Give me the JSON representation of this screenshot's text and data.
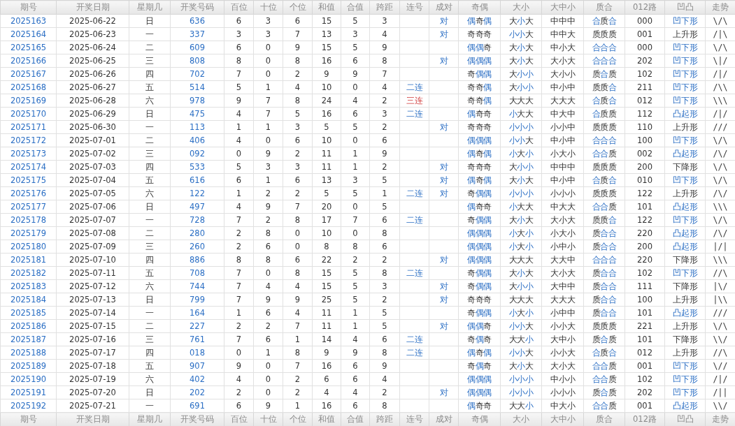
{
  "table": {
    "columns": [
      "期号",
      "开奖日期",
      "星期几",
      "开奖号码",
      "百位",
      "十位",
      "个位",
      "和值",
      "合值",
      "跨距",
      "连号",
      "成对",
      "奇偶",
      "大小",
      "大中小",
      "质合",
      "012路",
      "凹凸",
      "走势"
    ],
    "rows": [
      {
        "issue": "2025163",
        "date": "2025-06-22",
        "weekday": "日",
        "number": "636",
        "hundreds": "6",
        "tens": "3",
        "units": "6",
        "sum": "15",
        "sum_tail": "5",
        "span": "3",
        "pair": "对",
        "odd_even": [
          {
            "t": "偶",
            "highlighted": true
          },
          {
            "t": "奇",
            "highlighted": false
          },
          {
            "t": "偶",
            "highlighted": true
          }
        ],
        "big_small": [
          {
            "t": "大",
            "highlighted": false
          },
          {
            "t": "小",
            "highlighted": true
          },
          {
            "t": "大",
            "highlighted": false
          }
        ],
        "big_mid_small": "中中中",
        "prime": [
          {
            "t": "合",
            "highlighted": true
          },
          {
            "t": "质",
            "highlighted": false
          },
          {
            "t": "合",
            "highlighted": true
          }
        ],
        "route": "000",
        "shape": {
          "text": "凹下形",
          "kind": "link"
        },
        "trend": "\\/\\"
      },
      {
        "issue": "2025164",
        "date": "2025-06-23",
        "weekday": "一",
        "number": "337",
        "hundreds": "3",
        "tens": "3",
        "units": "7",
        "sum": "13",
        "sum_tail": "3",
        "span": "4",
        "pair": "对",
        "odd_even": [
          {
            "t": "奇奇奇",
            "highlighted": false
          }
        ],
        "big_small": [
          {
            "t": "小小",
            "highlighted": true
          },
          {
            "t": "大",
            "highlighted": false
          }
        ],
        "big_mid_small": "中中大",
        "prime": [
          {
            "t": "质质质",
            "highlighted": false
          }
        ],
        "route": "001",
        "shape": {
          "text": "上升形",
          "kind": "plain"
        },
        "trend": "/|\\"
      },
      {
        "issue": "2025165",
        "date": "2025-06-24",
        "weekday": "二",
        "number": "609",
        "hundreds": "6",
        "tens": "0",
        "units": "9",
        "sum": "15",
        "sum_tail": "5",
        "span": "9",
        "odd_even": [
          {
            "t": "偶偶",
            "highlighted": true
          },
          {
            "t": "奇",
            "highlighted": false
          }
        ],
        "big_small": [
          {
            "t": "大",
            "highlighted": false
          },
          {
            "t": "小",
            "highlighted": true
          },
          {
            "t": "大",
            "highlighted": false
          }
        ],
        "big_mid_small": "中小大",
        "prime": [
          {
            "t": "合合合",
            "highlighted": true
          }
        ],
        "route": "000",
        "shape": {
          "text": "凹下形",
          "kind": "link"
        },
        "trend": "\\/\\"
      },
      {
        "issue": "2025166",
        "date": "2025-06-25",
        "weekday": "三",
        "number": "808",
        "hundreds": "8",
        "tens": "0",
        "units": "8",
        "sum": "16",
        "sum_tail": "6",
        "span": "8",
        "pair": "对",
        "odd_even": [
          {
            "t": "偶偶偶",
            "highlighted": true
          }
        ],
        "big_small": [
          {
            "t": "大",
            "highlighted": false
          },
          {
            "t": "小",
            "highlighted": true
          },
          {
            "t": "大",
            "highlighted": false
          }
        ],
        "big_mid_small": "大小大",
        "prime": [
          {
            "t": "合合合",
            "highlighted": true
          }
        ],
        "route": "202",
        "shape": {
          "text": "凹下形",
          "kind": "link"
        },
        "trend": "\\|/"
      },
      {
        "issue": "2025167",
        "date": "2025-06-26",
        "weekday": "四",
        "number": "702",
        "hundreds": "7",
        "tens": "0",
        "units": "2",
        "sum": "9",
        "sum_tail": "9",
        "span": "7",
        "odd_even": [
          {
            "t": "奇",
            "highlighted": false
          },
          {
            "t": "偶偶",
            "highlighted": true
          }
        ],
        "big_small": [
          {
            "t": "大",
            "highlighted": false
          },
          {
            "t": "小小",
            "highlighted": true
          }
        ],
        "big_mid_small": "大小小",
        "prime": [
          {
            "t": "质",
            "highlighted": false
          },
          {
            "t": "合",
            "highlighted": true
          },
          {
            "t": "质",
            "highlighted": false
          }
        ],
        "route": "102",
        "shape": {
          "text": "凹下形",
          "kind": "link"
        },
        "trend": "/|/"
      },
      {
        "issue": "2025168",
        "date": "2025-06-27",
        "weekday": "五",
        "number": "514",
        "hundreds": "5",
        "tens": "1",
        "units": "4",
        "sum": "10",
        "sum_tail": "0",
        "span": "4",
        "consecutive": {
          "text": "二连",
          "kind": "link"
        },
        "odd_even": [
          {
            "t": "奇奇",
            "highlighted": false
          },
          {
            "t": "偶",
            "highlighted": true
          }
        ],
        "big_small": [
          {
            "t": "大",
            "highlighted": false
          },
          {
            "t": "小小",
            "highlighted": true
          }
        ],
        "big_mid_small": "中小中",
        "prime": [
          {
            "t": "质质",
            "highlighted": false
          },
          {
            "t": "合",
            "highlighted": true
          }
        ],
        "route": "211",
        "shape": {
          "text": "凹下形",
          "kind": "link"
        },
        "trend": "/\\\\"
      },
      {
        "issue": "2025169",
        "date": "2025-06-28",
        "weekday": "六",
        "number": "978",
        "hundreds": "9",
        "tens": "7",
        "units": "8",
        "sum": "24",
        "sum_tail": "4",
        "span": "2",
        "consecutive": {
          "text": "三连",
          "kind": "alert"
        },
        "odd_even": [
          {
            "t": "奇奇",
            "highlighted": false
          },
          {
            "t": "偶",
            "highlighted": true
          }
        ],
        "big_small": [
          {
            "t": "大大大",
            "highlighted": false
          }
        ],
        "big_mid_small": "大大大",
        "prime": [
          {
            "t": "合",
            "highlighted": true
          },
          {
            "t": "质",
            "highlighted": false
          },
          {
            "t": "合",
            "highlighted": true
          }
        ],
        "route": "012",
        "shape": {
          "text": "凹下形",
          "kind": "link"
        },
        "trend": "\\\\\\"
      },
      {
        "issue": "2025170",
        "date": "2025-06-29",
        "weekday": "日",
        "number": "475",
        "hundreds": "4",
        "tens": "7",
        "units": "5",
        "sum": "16",
        "sum_tail": "6",
        "span": "3",
        "consecutive": {
          "text": "二连",
          "kind": "link"
        },
        "odd_even": [
          {
            "t": "偶",
            "highlighted": true
          },
          {
            "t": "奇奇",
            "highlighted": false
          }
        ],
        "big_small": [
          {
            "t": "小",
            "highlighted": true
          },
          {
            "t": "大大",
            "highlighted": false
          }
        ],
        "big_mid_small": "中大中",
        "prime": [
          {
            "t": "合",
            "highlighted": true
          },
          {
            "t": "质质",
            "highlighted": false
          }
        ],
        "route": "112",
        "shape": {
          "text": "凸起形",
          "kind": "link"
        },
        "trend": "/|/"
      },
      {
        "issue": "2025171",
        "date": "2025-06-30",
        "weekday": "一",
        "number": "113",
        "hundreds": "1",
        "tens": "1",
        "units": "3",
        "sum": "5",
        "sum_tail": "5",
        "span": "2",
        "pair": "对",
        "odd_even": [
          {
            "t": "奇奇奇",
            "highlighted": false
          }
        ],
        "big_small": [
          {
            "t": "小小小",
            "highlighted": true
          }
        ],
        "big_mid_small": "小小中",
        "prime": [
          {
            "t": "质质质",
            "highlighted": false
          }
        ],
        "route": "110",
        "shape": {
          "text": "上升形",
          "kind": "plain"
        },
        "trend": "///"
      },
      {
        "issue": "2025172",
        "date": "2025-07-01",
        "weekday": "二",
        "number": "406",
        "hundreds": "4",
        "tens": "0",
        "units": "6",
        "sum": "10",
        "sum_tail": "0",
        "span": "6",
        "odd_even": [
          {
            "t": "偶偶偶",
            "highlighted": true
          }
        ],
        "big_small": [
          {
            "t": "小小",
            "highlighted": true
          },
          {
            "t": "大",
            "highlighted": false
          }
        ],
        "big_mid_small": "中小中",
        "prime": [
          {
            "t": "合合合",
            "highlighted": true
          }
        ],
        "route": "100",
        "shape": {
          "text": "凹下形",
          "kind": "link"
        },
        "trend": "\\/\\"
      },
      {
        "issue": "2025173",
        "date": "2025-07-02",
        "weekday": "三",
        "number": "092",
        "hundreds": "0",
        "tens": "9",
        "units": "2",
        "sum": "11",
        "sum_tail": "1",
        "span": "9",
        "odd_even": [
          {
            "t": "偶",
            "highlighted": true
          },
          {
            "t": "奇",
            "highlighted": false
          },
          {
            "t": "偶",
            "highlighted": true
          }
        ],
        "big_small": [
          {
            "t": "小",
            "highlighted": true
          },
          {
            "t": "大",
            "highlighted": false
          },
          {
            "t": "小",
            "highlighted": true
          }
        ],
        "big_mid_small": "小大小",
        "prime": [
          {
            "t": "合合",
            "highlighted": true
          },
          {
            "t": "质",
            "highlighted": false
          }
        ],
        "route": "002",
        "shape": {
          "text": "凸起形",
          "kind": "link"
        },
        "trend": "/\\/"
      },
      {
        "issue": "2025174",
        "date": "2025-07-03",
        "weekday": "四",
        "number": "533",
        "hundreds": "5",
        "tens": "3",
        "units": "3",
        "sum": "11",
        "sum_tail": "1",
        "span": "2",
        "pair": "对",
        "odd_even": [
          {
            "t": "奇奇奇",
            "highlighted": false
          }
        ],
        "big_small": [
          {
            "t": "大",
            "highlighted": false
          },
          {
            "t": "小小",
            "highlighted": true
          }
        ],
        "big_mid_small": "中中中",
        "prime": [
          {
            "t": "质质质",
            "highlighted": false
          }
        ],
        "route": "200",
        "shape": {
          "text": "下降形",
          "kind": "plain"
        },
        "trend": "\\/\\"
      },
      {
        "issue": "2025175",
        "date": "2025-07-04",
        "weekday": "五",
        "number": "616",
        "hundreds": "6",
        "tens": "1",
        "units": "6",
        "sum": "13",
        "sum_tail": "3",
        "span": "5",
        "pair": "对",
        "odd_even": [
          {
            "t": "偶",
            "highlighted": true
          },
          {
            "t": "奇",
            "highlighted": false
          },
          {
            "t": "偶",
            "highlighted": true
          }
        ],
        "big_small": [
          {
            "t": "大",
            "highlighted": false
          },
          {
            "t": "小",
            "highlighted": true
          },
          {
            "t": "大",
            "highlighted": false
          }
        ],
        "big_mid_small": "中小中",
        "prime": [
          {
            "t": "合",
            "highlighted": true
          },
          {
            "t": "质",
            "highlighted": false
          },
          {
            "t": "合",
            "highlighted": true
          }
        ],
        "route": "010",
        "shape": {
          "text": "凹下形",
          "kind": "link"
        },
        "trend": "\\/\\"
      },
      {
        "issue": "2025176",
        "date": "2025-07-05",
        "weekday": "六",
        "number": "122",
        "hundreds": "1",
        "tens": "2",
        "units": "2",
        "sum": "5",
        "sum_tail": "5",
        "span": "1",
        "consecutive": {
          "text": "二连",
          "kind": "link"
        },
        "pair": "对",
        "odd_even": [
          {
            "t": "奇",
            "highlighted": false
          },
          {
            "t": "偶偶",
            "highlighted": true
          }
        ],
        "big_small": [
          {
            "t": "小小小",
            "highlighted": true
          }
        ],
        "big_mid_small": "小小小",
        "prime": [
          {
            "t": "质质质",
            "highlighted": false
          }
        ],
        "route": "122",
        "shape": {
          "text": "上升形",
          "kind": "plain"
        },
        "trend": "/\\/"
      },
      {
        "issue": "2025177",
        "date": "2025-07-06",
        "weekday": "日",
        "number": "497",
        "hundreds": "4",
        "tens": "9",
        "units": "7",
        "sum": "20",
        "sum_tail": "0",
        "span": "5",
        "odd_even": [
          {
            "t": "偶",
            "highlighted": true
          },
          {
            "t": "奇奇",
            "highlighted": false
          }
        ],
        "big_small": [
          {
            "t": "小",
            "highlighted": true
          },
          {
            "t": "大大",
            "highlighted": false
          }
        ],
        "big_mid_small": "中大大",
        "prime": [
          {
            "t": "合合",
            "highlighted": true
          },
          {
            "t": "质",
            "highlighted": false
          }
        ],
        "route": "101",
        "shape": {
          "text": "凸起形",
          "kind": "link"
        },
        "trend": "\\\\\\"
      },
      {
        "issue": "2025178",
        "date": "2025-07-07",
        "weekday": "一",
        "number": "728",
        "hundreds": "7",
        "tens": "2",
        "units": "8",
        "sum": "17",
        "sum_tail": "7",
        "span": "6",
        "consecutive": {
          "text": "二连",
          "kind": "link"
        },
        "odd_even": [
          {
            "t": "奇",
            "highlighted": false
          },
          {
            "t": "偶偶",
            "highlighted": true
          }
        ],
        "big_small": [
          {
            "t": "大",
            "highlighted": false
          },
          {
            "t": "小",
            "highlighted": true
          },
          {
            "t": "大",
            "highlighted": false
          }
        ],
        "big_mid_small": "大小大",
        "prime": [
          {
            "t": "质质",
            "highlighted": false
          },
          {
            "t": "合",
            "highlighted": true
          }
        ],
        "route": "122",
        "shape": {
          "text": "凹下形",
          "kind": "link"
        },
        "trend": "\\/\\"
      },
      {
        "issue": "2025179",
        "date": "2025-07-08",
        "weekday": "二",
        "number": "280",
        "hundreds": "2",
        "tens": "8",
        "units": "0",
        "sum": "10",
        "sum_tail": "0",
        "span": "8",
        "odd_even": [
          {
            "t": "偶偶偶",
            "highlighted": true
          }
        ],
        "big_small": [
          {
            "t": "小",
            "highlighted": true
          },
          {
            "t": "大",
            "highlighted": false
          },
          {
            "t": "小",
            "highlighted": true
          }
        ],
        "big_mid_small": "小大小",
        "prime": [
          {
            "t": "质",
            "highlighted": false
          },
          {
            "t": "合合",
            "highlighted": true
          }
        ],
        "route": "220",
        "shape": {
          "text": "凸起形",
          "kind": "link"
        },
        "trend": "/\\/"
      },
      {
        "issue": "2025180",
        "date": "2025-07-09",
        "weekday": "三",
        "number": "260",
        "hundreds": "2",
        "tens": "6",
        "units": "0",
        "sum": "8",
        "sum_tail": "8",
        "span": "6",
        "odd_even": [
          {
            "t": "偶偶偶",
            "highlighted": true
          }
        ],
        "big_small": [
          {
            "t": "小",
            "highlighted": true
          },
          {
            "t": "大",
            "highlighted": false
          },
          {
            "t": "小",
            "highlighted": true
          }
        ],
        "big_mid_small": "小中小",
        "prime": [
          {
            "t": "质",
            "highlighted": false
          },
          {
            "t": "合合",
            "highlighted": true
          }
        ],
        "route": "200",
        "shape": {
          "text": "凸起形",
          "kind": "link"
        },
        "trend": "|/|"
      },
      {
        "issue": "2025181",
        "date": "2025-07-10",
        "weekday": "四",
        "number": "886",
        "hundreds": "8",
        "tens": "8",
        "units": "6",
        "sum": "22",
        "sum_tail": "2",
        "span": "2",
        "pair": "对",
        "odd_even": [
          {
            "t": "偶偶偶",
            "highlighted": true
          }
        ],
        "big_small": [
          {
            "t": "大大大",
            "highlighted": false
          }
        ],
        "big_mid_small": "大大中",
        "prime": [
          {
            "t": "合合合",
            "highlighted": true
          }
        ],
        "route": "220",
        "shape": {
          "text": "下降形",
          "kind": "plain"
        },
        "trend": "\\\\\\"
      },
      {
        "issue": "2025182",
        "date": "2025-07-11",
        "weekday": "五",
        "number": "708",
        "hundreds": "7",
        "tens": "0",
        "units": "8",
        "sum": "15",
        "sum_tail": "5",
        "span": "8",
        "consecutive": {
          "text": "二连",
          "kind": "link"
        },
        "odd_even": [
          {
            "t": "奇",
            "highlighted": false
          },
          {
            "t": "偶偶",
            "highlighted": true
          }
        ],
        "big_small": [
          {
            "t": "大",
            "highlighted": false
          },
          {
            "t": "小",
            "highlighted": true
          },
          {
            "t": "大",
            "highlighted": false
          }
        ],
        "big_mid_small": "大小大",
        "prime": [
          {
            "t": "质",
            "highlighted": false
          },
          {
            "t": "合合",
            "highlighted": true
          }
        ],
        "route": "102",
        "shape": {
          "text": "凹下形",
          "kind": "link"
        },
        "trend": "//\\"
      },
      {
        "issue": "2025183",
        "date": "2025-07-12",
        "weekday": "六",
        "number": "744",
        "hundreds": "7",
        "tens": "4",
        "units": "4",
        "sum": "15",
        "sum_tail": "5",
        "span": "3",
        "pair": "对",
        "odd_even": [
          {
            "t": "奇",
            "highlighted": false
          },
          {
            "t": "偶偶",
            "highlighted": true
          }
        ],
        "big_small": [
          {
            "t": "大",
            "highlighted": false
          },
          {
            "t": "小小",
            "highlighted": true
          }
        ],
        "big_mid_small": "大中中",
        "prime": [
          {
            "t": "质",
            "highlighted": false
          },
          {
            "t": "合合",
            "highlighted": true
          }
        ],
        "route": "111",
        "shape": {
          "text": "下降形",
          "kind": "plain"
        },
        "trend": "|\\/"
      },
      {
        "issue": "2025184",
        "date": "2025-07-13",
        "weekday": "日",
        "number": "799",
        "hundreds": "7",
        "tens": "9",
        "units": "9",
        "sum": "25",
        "sum_tail": "5",
        "span": "2",
        "pair": "对",
        "odd_even": [
          {
            "t": "奇奇奇",
            "highlighted": false
          }
        ],
        "big_small": [
          {
            "t": "大大大",
            "highlighted": false
          }
        ],
        "big_mid_small": "大大大",
        "prime": [
          {
            "t": "质",
            "highlighted": false
          },
          {
            "t": "合合",
            "highlighted": true
          }
        ],
        "route": "100",
        "shape": {
          "text": "上升形",
          "kind": "plain"
        },
        "trend": "|\\\\"
      },
      {
        "issue": "2025185",
        "date": "2025-07-14",
        "weekday": "一",
        "number": "164",
        "hundreds": "1",
        "tens": "6",
        "units": "4",
        "sum": "11",
        "sum_tail": "1",
        "span": "5",
        "odd_even": [
          {
            "t": "奇",
            "highlighted": false
          },
          {
            "t": "偶偶",
            "highlighted": true
          }
        ],
        "big_small": [
          {
            "t": "小",
            "highlighted": true
          },
          {
            "t": "大",
            "highlighted": false
          },
          {
            "t": "小",
            "highlighted": true
          }
        ],
        "big_mid_small": "小中中",
        "prime": [
          {
            "t": "质",
            "highlighted": false
          },
          {
            "t": "合合",
            "highlighted": true
          }
        ],
        "route": "101",
        "shape": {
          "text": "凸起形",
          "kind": "link"
        },
        "trend": "///"
      },
      {
        "issue": "2025186",
        "date": "2025-07-15",
        "weekday": "二",
        "number": "227",
        "hundreds": "2",
        "tens": "2",
        "units": "7",
        "sum": "11",
        "sum_tail": "1",
        "span": "5",
        "pair": "对",
        "odd_even": [
          {
            "t": "偶偶",
            "highlighted": true
          },
          {
            "t": "奇",
            "highlighted": false
          }
        ],
        "big_small": [
          {
            "t": "小小",
            "highlighted": true
          },
          {
            "t": "大",
            "highlighted": false
          }
        ],
        "big_mid_small": "小小大",
        "prime": [
          {
            "t": "质质质",
            "highlighted": false
          }
        ],
        "route": "221",
        "shape": {
          "text": "上升形",
          "kind": "plain"
        },
        "trend": "\\/\\"
      },
      {
        "issue": "2025187",
        "date": "2025-07-16",
        "weekday": "三",
        "number": "761",
        "hundreds": "7",
        "tens": "6",
        "units": "1",
        "sum": "14",
        "sum_tail": "4",
        "span": "6",
        "consecutive": {
          "text": "二连",
          "kind": "link"
        },
        "odd_even": [
          {
            "t": "奇",
            "highlighted": false
          },
          {
            "t": "偶",
            "highlighted": true
          },
          {
            "t": "奇",
            "highlighted": false
          }
        ],
        "big_small": [
          {
            "t": "大大",
            "highlighted": false
          },
          {
            "t": "小",
            "highlighted": true
          }
        ],
        "big_mid_small": "大中小",
        "prime": [
          {
            "t": "质",
            "highlighted": false
          },
          {
            "t": "合",
            "highlighted": true
          },
          {
            "t": "质",
            "highlighted": false
          }
        ],
        "route": "101",
        "shape": {
          "text": "下降形",
          "kind": "plain"
        },
        "trend": "\\\\/"
      },
      {
        "issue": "2025188",
        "date": "2025-07-17",
        "weekday": "四",
        "number": "018",
        "hundreds": "0",
        "tens": "1",
        "units": "8",
        "sum": "9",
        "sum_tail": "9",
        "span": "8",
        "consecutive": {
          "text": "二连",
          "kind": "link"
        },
        "odd_even": [
          {
            "t": "偶",
            "highlighted": true
          },
          {
            "t": "奇",
            "highlighted": false
          },
          {
            "t": "偶",
            "highlighted": true
          }
        ],
        "big_small": [
          {
            "t": "小小",
            "highlighted": true
          },
          {
            "t": "大",
            "highlighted": false
          }
        ],
        "big_mid_small": "小小大",
        "prime": [
          {
            "t": "合",
            "highlighted": true
          },
          {
            "t": "质",
            "highlighted": false
          },
          {
            "t": "合",
            "highlighted": true
          }
        ],
        "route": "012",
        "shape": {
          "text": "上升形",
          "kind": "plain"
        },
        "trend": "//\\"
      },
      {
        "issue": "2025189",
        "date": "2025-07-18",
        "weekday": "五",
        "number": "907",
        "hundreds": "9",
        "tens": "0",
        "units": "7",
        "sum": "16",
        "sum_tail": "6",
        "span": "9",
        "odd_even": [
          {
            "t": "奇",
            "highlighted": false
          },
          {
            "t": "偶",
            "highlighted": true
          },
          {
            "t": "奇",
            "highlighted": false
          }
        ],
        "big_small": [
          {
            "t": "大",
            "highlighted": false
          },
          {
            "t": "小",
            "highlighted": true
          },
          {
            "t": "大",
            "highlighted": false
          }
        ],
        "big_mid_small": "大小大",
        "prime": [
          {
            "t": "合合",
            "highlighted": true
          },
          {
            "t": "质",
            "highlighted": false
          }
        ],
        "route": "001",
        "shape": {
          "text": "凹下形",
          "kind": "link"
        },
        "trend": "\\//"
      },
      {
        "issue": "2025190",
        "date": "2025-07-19",
        "weekday": "六",
        "number": "402",
        "hundreds": "4",
        "tens": "0",
        "units": "2",
        "sum": "6",
        "sum_tail": "6",
        "span": "4",
        "odd_even": [
          {
            "t": "偶偶偶",
            "highlighted": true
          }
        ],
        "big_small": [
          {
            "t": "小小小",
            "highlighted": true
          }
        ],
        "big_mid_small": "中小小",
        "prime": [
          {
            "t": "合合",
            "highlighted": true
          },
          {
            "t": "质",
            "highlighted": false
          }
        ],
        "route": "102",
        "shape": {
          "text": "凹下形",
          "kind": "link"
        },
        "trend": "/|/"
      },
      {
        "issue": "2025191",
        "date": "2025-07-20",
        "weekday": "日",
        "number": "202",
        "hundreds": "2",
        "tens": "0",
        "units": "2",
        "sum": "4",
        "sum_tail": "4",
        "span": "2",
        "pair": "对",
        "odd_even": [
          {
            "t": "偶偶偶",
            "highlighted": true
          }
        ],
        "big_small": [
          {
            "t": "小小小",
            "highlighted": true
          }
        ],
        "big_mid_small": "小小小",
        "prime": [
          {
            "t": "质",
            "highlighted": false
          },
          {
            "t": "合",
            "highlighted": true
          },
          {
            "t": "质",
            "highlighted": false
          }
        ],
        "route": "202",
        "shape": {
          "text": "凹下形",
          "kind": "link"
        },
        "trend": "/||"
      },
      {
        "issue": "2025192",
        "date": "2025-07-21",
        "weekday": "一",
        "number": "691",
        "hundreds": "6",
        "tens": "9",
        "units": "1",
        "sum": "16",
        "sum_tail": "6",
        "span": "8",
        "odd_even": [
          {
            "t": "偶",
            "highlighted": true
          },
          {
            "t": "奇奇",
            "highlighted": false
          }
        ],
        "big_small": [
          {
            "t": "大大",
            "highlighted": false
          },
          {
            "t": "小",
            "highlighted": true
          }
        ],
        "big_mid_small": "中大小",
        "prime": [
          {
            "t": "合合",
            "highlighted": true
          },
          {
            "t": "质",
            "highlighted": false
          }
        ],
        "route": "001",
        "shape": {
          "text": "凸起形",
          "kind": "link"
        },
        "trend": "\\\\/"
      }
    ],
    "footer_columns": [
      "期号",
      "开奖日期",
      "星期几",
      "开奖号码",
      "百位",
      "十位",
      "个位",
      "和值",
      "合值",
      "跨距",
      "连号",
      "成对",
      "奇偶",
      "大小",
      "大中小",
      "质合",
      "012路",
      "凹凸",
      "走势"
    ]
  }
}
